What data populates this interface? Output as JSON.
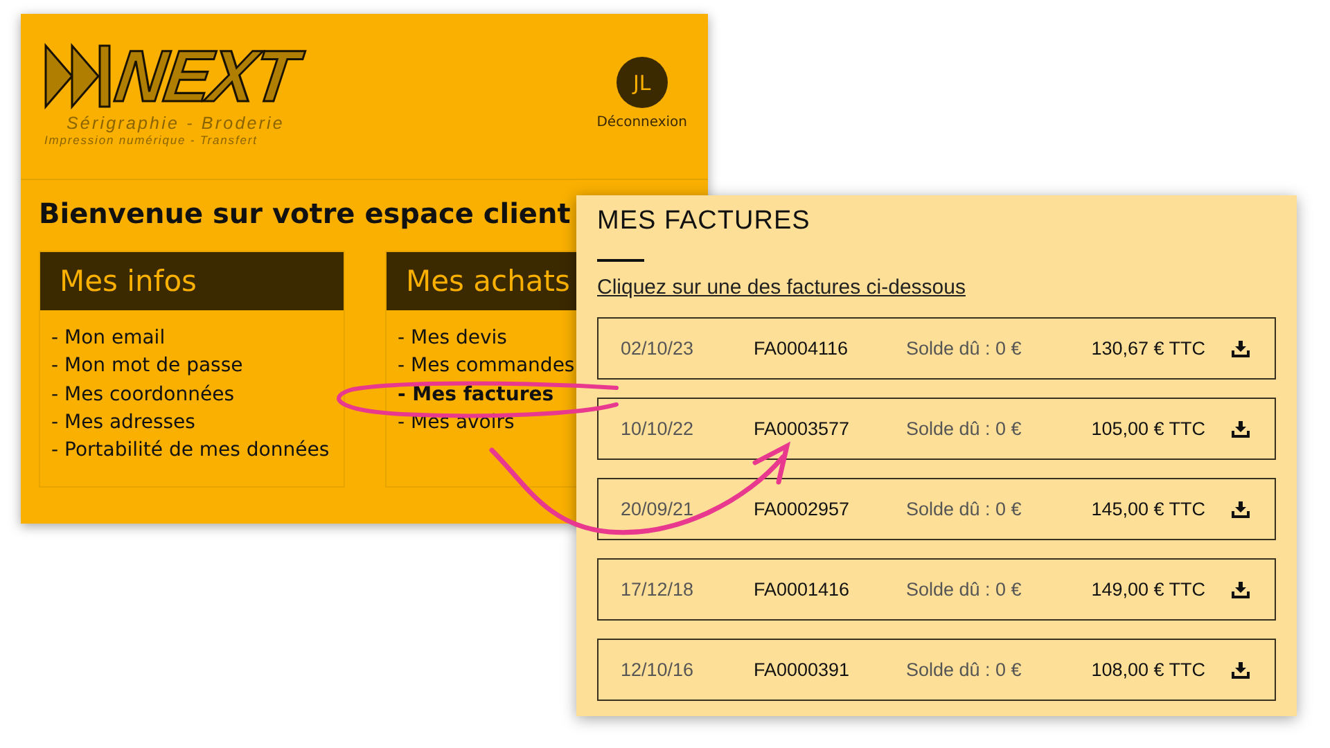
{
  "header": {
    "logo": {
      "name": "NEXT",
      "tagline": "Sérigraphie - Broderie",
      "subtagline": "Impression numérique - Transfert"
    },
    "avatar": "JL",
    "logout": "Déconnexion"
  },
  "welcome": "Bienvenue sur votre espace client",
  "sections": [
    {
      "title": "Mes infos",
      "items": [
        {
          "label": "- Mon email",
          "selected": false
        },
        {
          "label": "- Mon mot de passe",
          "selected": false
        },
        {
          "label": "- Mes coordonnées",
          "selected": false
        },
        {
          "label": "- Mes adresses",
          "selected": false
        },
        {
          "label": "- Portabilité de mes données",
          "selected": false
        }
      ]
    },
    {
      "title": "Mes achats",
      "items": [
        {
          "label": "- Mes devis",
          "selected": false
        },
        {
          "label": "- Mes commandes",
          "selected": false
        },
        {
          "label": "- Mes factures",
          "selected": true
        },
        {
          "label": "- Mes avoirs",
          "selected": false
        }
      ]
    }
  ],
  "invoices_panel": {
    "title": "MES FACTURES",
    "instruction": "Cliquez sur une des factures ci-dessous",
    "invoices": [
      {
        "date": "02/10/23",
        "number": "FA0004116",
        "balance": "Solde dû : 0 €",
        "amount": "130,67 € TTC"
      },
      {
        "date": "10/10/22",
        "number": "FA0003577",
        "balance": "Solde dû : 0 €",
        "amount": "105,00 € TTC"
      },
      {
        "date": "20/09/21",
        "number": "FA0002957",
        "balance": "Solde dû : 0 €",
        "amount": "145,00 € TTC"
      },
      {
        "date": "17/12/18",
        "number": "FA0001416",
        "balance": "Solde dû : 0 €",
        "amount": "149,00 € TTC"
      },
      {
        "date": "12/10/16",
        "number": "FA0000391",
        "balance": "Solde dû : 0 €",
        "amount": "108,00 € TTC"
      }
    ]
  }
}
